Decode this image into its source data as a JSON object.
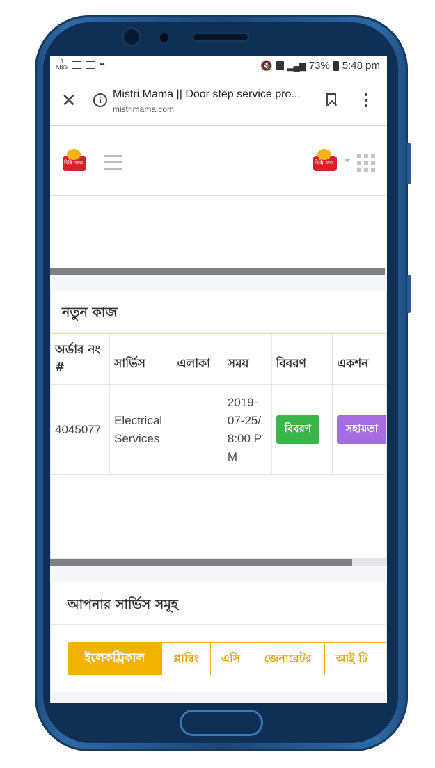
{
  "status_bar": {
    "speed_value": "3",
    "speed_unit": "KB/s",
    "dots": "••",
    "battery_pct": "73%",
    "time": "5:48 pm"
  },
  "browser": {
    "page_title": "Mistri Mama || Door step service pro...",
    "domain": "mistrimama.com"
  },
  "header": {
    "logo_text": "মিস্ত্রি মামা"
  },
  "new_jobs": {
    "title": "নতুন কাজ",
    "columns": [
      "অর্ডার নং #",
      "সার্ভিস",
      "এলাকা",
      "সময়",
      "বিবরণ",
      "একশন"
    ],
    "rows": [
      {
        "order_no": "4045077",
        "service": "Electrical Services",
        "area": "",
        "time": "2019-07-25/8:00 PM",
        "detail_label": "বিবরণ",
        "action_label": "সহায়তা"
      }
    ]
  },
  "services": {
    "title": "আপনার সার্ভিস সমূহ",
    "tabs": [
      "ইলেকট্রিকাল",
      "প্লাম্বিং",
      "এসি",
      "জেনারেটর",
      "আই টি"
    ]
  },
  "colors": {
    "accent_yellow": "#f0b400",
    "detail_green": "#39b54a",
    "help_purple": "#a66de0"
  }
}
